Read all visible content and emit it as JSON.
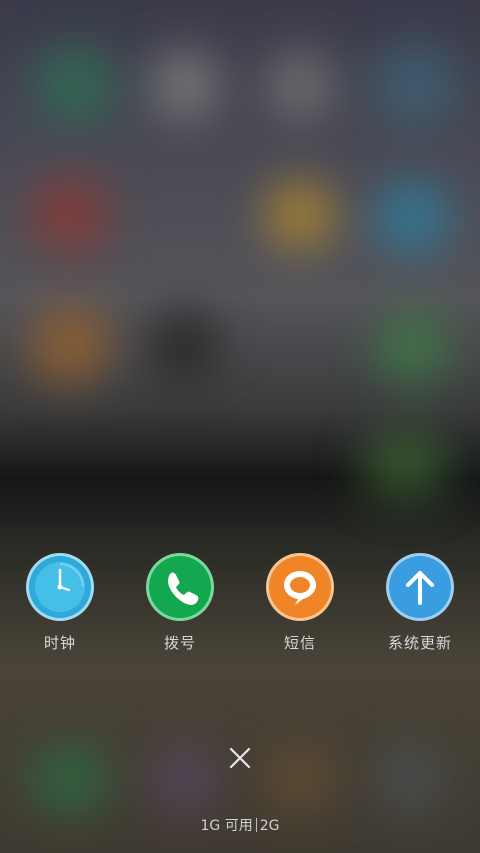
{
  "dock": {
    "apps": [
      {
        "label": "时钟",
        "icon": "clock-icon",
        "color": "#3fb8e6"
      },
      {
        "label": "拨号",
        "icon": "phone-icon",
        "color": "#18b35a"
      },
      {
        "label": "短信",
        "icon": "message-icon",
        "color": "#f08a2c"
      },
      {
        "label": "系统更新",
        "icon": "arrow-up-icon",
        "color": "#3a9fe0"
      }
    ]
  },
  "close": {
    "icon": "close-icon"
  },
  "memory": {
    "free_text": "1G 可用",
    "total_text": "2G"
  }
}
